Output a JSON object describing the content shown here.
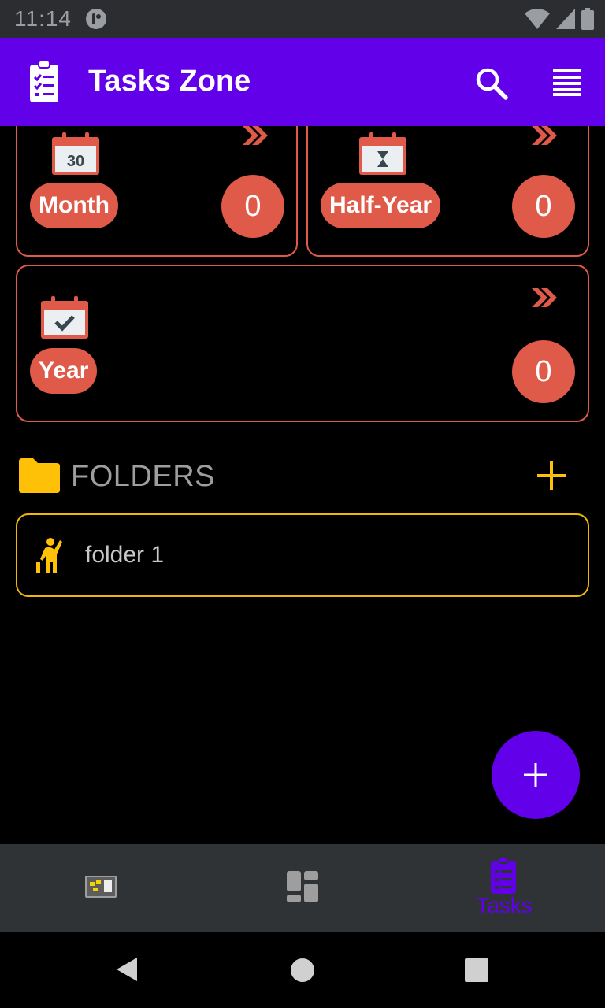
{
  "status_bar": {
    "time": "11:14"
  },
  "app_bar": {
    "title": "Tasks Zone",
    "icons": [
      "clipboard-list-icon",
      "search-icon",
      "menu-icon"
    ]
  },
  "period_cards": [
    {
      "label": "Month",
      "count": "0",
      "calendar_text": "30",
      "icon": "calendar-30-icon"
    },
    {
      "label": "Half-Year",
      "count": "0",
      "icon": "calendar-hourglass-icon"
    },
    {
      "label": "Year",
      "count": "0",
      "icon": "calendar-check-icon"
    }
  ],
  "folders": {
    "title": "FOLDERS",
    "items": [
      {
        "name": "folder 1",
        "icon": "person-waving-icon"
      }
    ]
  },
  "bottom_nav": {
    "items": [
      {
        "name": "notes",
        "icon": "sticky-notes-board-icon",
        "active": false
      },
      {
        "name": "dashboard",
        "icon": "dashboard-icon",
        "active": false
      },
      {
        "name": "tasks",
        "label": "Tasks",
        "icon": "clipboard-list-icon",
        "active": true
      }
    ]
  },
  "colors": {
    "primary": "#6200ea",
    "card_accent": "#e05a4a",
    "folder_accent": "#f2b705",
    "background": "#000000",
    "status_bar": "#2b2d30",
    "bottom_nav": "#303336"
  }
}
